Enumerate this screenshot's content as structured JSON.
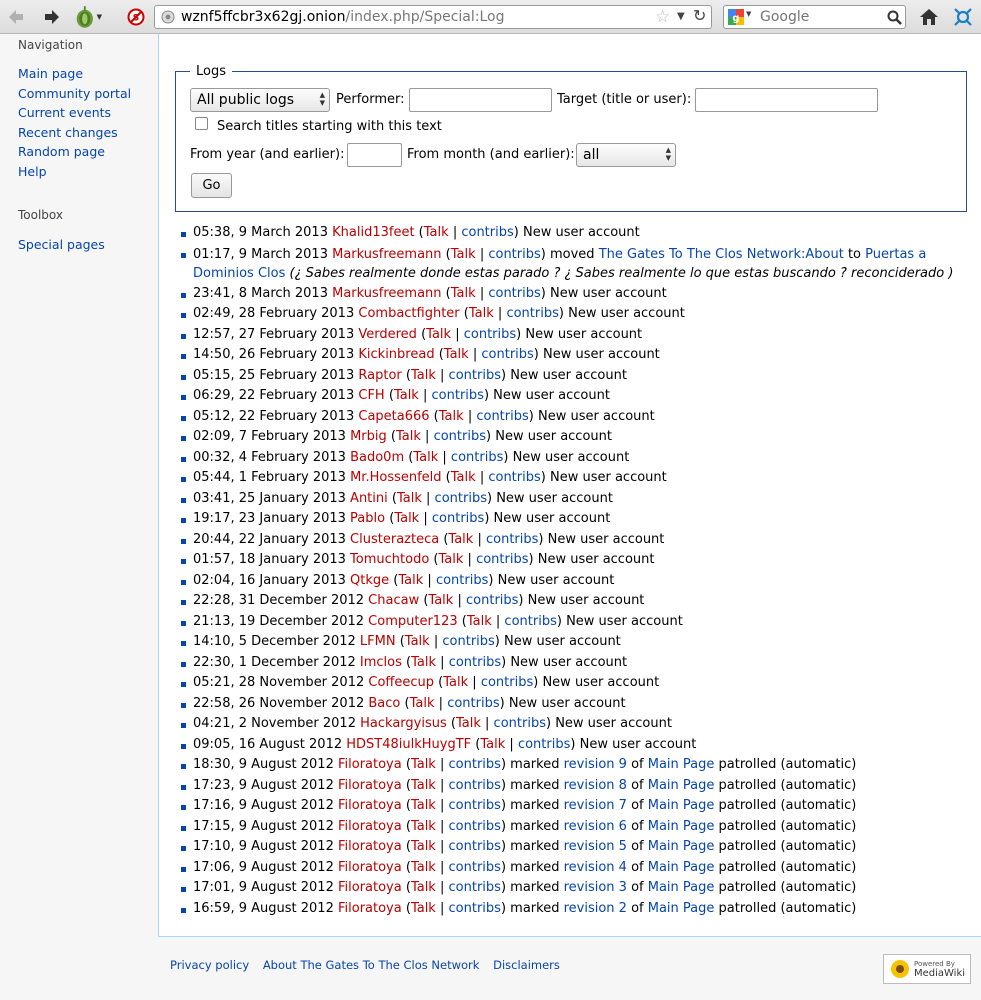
{
  "browser": {
    "url_host": "wznf5ffcbr3x62gj.onion",
    "url_path": "/index.php/Special:Log",
    "search_placeholder": "Google"
  },
  "sidebar": {
    "top_partial_heading": "Navigation",
    "navigation": [
      "Main page",
      "Community portal",
      "Current events",
      "Recent changes",
      "Random page",
      "Help"
    ],
    "toolbox_heading": "Toolbox",
    "toolbox": [
      "Special pages"
    ]
  },
  "form": {
    "legend": "Logs",
    "log_type": "All public logs",
    "performer_label": "Performer:",
    "target_label": "Target (title or user):",
    "prefix_label": "Search titles starting with this text",
    "year_label": "From year (and earlier):",
    "month_label": "From month (and earlier):",
    "month_value": "all",
    "go_label": "Go"
  },
  "log_entries": [
    {
      "time": "05:38, 9 March 2013",
      "user": "Khalid13feet",
      "action": "New user account"
    },
    {
      "time": "01:17, 9 March 2013",
      "user": "Markusfreemann",
      "verb": "moved",
      "from": "The Gates To The Clos Network:About",
      "to_word": "to",
      "to": "Puertas a Dominios Clos",
      "comment": "(¿ Sabes realmente donde estas parado ? ¿ Sabes realmente lo que estas buscando ? reconciderado )"
    },
    {
      "time": "23:41, 8 March 2013",
      "user": "Markusfreemann",
      "action": "New user account"
    },
    {
      "time": "02:49, 28 February 2013",
      "user": "Combactfighter",
      "action": "New user account"
    },
    {
      "time": "12:57, 27 February 2013",
      "user": "Verdered",
      "action": "New user account"
    },
    {
      "time": "14:50, 26 February 2013",
      "user": "Kickinbread",
      "action": "New user account"
    },
    {
      "time": "05:15, 25 February 2013",
      "user": "Raptor",
      "action": "New user account"
    },
    {
      "time": "06:29, 22 February 2013",
      "user": "CFH",
      "action": "New user account"
    },
    {
      "time": "05:12, 22 February 2013",
      "user": "Capeta666",
      "action": "New user account"
    },
    {
      "time": "02:09, 7 February 2013",
      "user": "Mrbig",
      "action": "New user account"
    },
    {
      "time": "00:32, 4 February 2013",
      "user": "Bado0m",
      "action": "New user account"
    },
    {
      "time": "05:44, 1 February 2013",
      "user": "Mr.Hossenfeld",
      "action": "New user account"
    },
    {
      "time": "03:41, 25 January 2013",
      "user": "Antini",
      "action": "New user account"
    },
    {
      "time": "19:17, 23 January 2013",
      "user": "Pablo",
      "action": "New user account"
    },
    {
      "time": "20:44, 22 January 2013",
      "user": "Clusterazteca",
      "action": "New user account"
    },
    {
      "time": "01:57, 18 January 2013",
      "user": "Tomuchtodo",
      "action": "New user account"
    },
    {
      "time": "02:04, 16 January 2013",
      "user": "Qtkge",
      "action": "New user account"
    },
    {
      "time": "22:28, 31 December 2012",
      "user": "Chacaw",
      "action": "New user account"
    },
    {
      "time": "21:13, 19 December 2012",
      "user": "Computer123",
      "action": "New user account"
    },
    {
      "time": "14:10, 5 December 2012",
      "user": "LFMN",
      "action": "New user account"
    },
    {
      "time": "22:30, 1 December 2012",
      "user": "Imclos",
      "action": "New user account"
    },
    {
      "time": "05:21, 28 November 2012",
      "user": "Coffeecup",
      "action": "New user account"
    },
    {
      "time": "22:58, 26 November 2012",
      "user": "Baco",
      "action": "New user account"
    },
    {
      "time": "04:21, 2 November 2012",
      "user": "Hackargyisus",
      "action": "New user account"
    },
    {
      "time": "09:05, 16 August 2012",
      "user": "HDST48iulkHuygTF",
      "action": "New user account"
    },
    {
      "time": "18:30, 9 August 2012",
      "user": "Filoratoya",
      "verb": "marked",
      "revision": "revision 9",
      "of": "of",
      "page": "Main Page",
      "suffix": "patrolled (automatic)"
    },
    {
      "time": "17:23, 9 August 2012",
      "user": "Filoratoya",
      "verb": "marked",
      "revision": "revision 8",
      "of": "of",
      "page": "Main Page",
      "suffix": "patrolled (automatic)"
    },
    {
      "time": "17:16, 9 August 2012",
      "user": "Filoratoya",
      "verb": "marked",
      "revision": "revision 7",
      "of": "of",
      "page": "Main Page",
      "suffix": "patrolled (automatic)"
    },
    {
      "time": "17:15, 9 August 2012",
      "user": "Filoratoya",
      "verb": "marked",
      "revision": "revision 6",
      "of": "of",
      "page": "Main Page",
      "suffix": "patrolled (automatic)"
    },
    {
      "time": "17:10, 9 August 2012",
      "user": "Filoratoya",
      "verb": "marked",
      "revision": "revision 5",
      "of": "of",
      "page": "Main Page",
      "suffix": "patrolled (automatic)"
    },
    {
      "time": "17:06, 9 August 2012",
      "user": "Filoratoya",
      "verb": "marked",
      "revision": "revision 4",
      "of": "of",
      "page": "Main Page",
      "suffix": "patrolled (automatic)"
    },
    {
      "time": "17:01, 9 August 2012",
      "user": "Filoratoya",
      "verb": "marked",
      "revision": "revision 3",
      "of": "of",
      "page": "Main Page",
      "suffix": "patrolled (automatic)"
    },
    {
      "time": "16:59, 9 August 2012",
      "user": "Filoratoya",
      "verb": "marked",
      "revision": "revision 2",
      "of": "of",
      "page": "Main Page",
      "suffix": "patrolled (automatic)"
    }
  ],
  "tool_links": {
    "talk": "Talk",
    "sep": "|",
    "contribs": "contribs"
  },
  "footer": {
    "links": [
      "Privacy policy",
      "About The Gates To The Clos Network",
      "Disclaimers"
    ],
    "powered_small": "Powered By",
    "powered_big": "MediaWiki"
  }
}
